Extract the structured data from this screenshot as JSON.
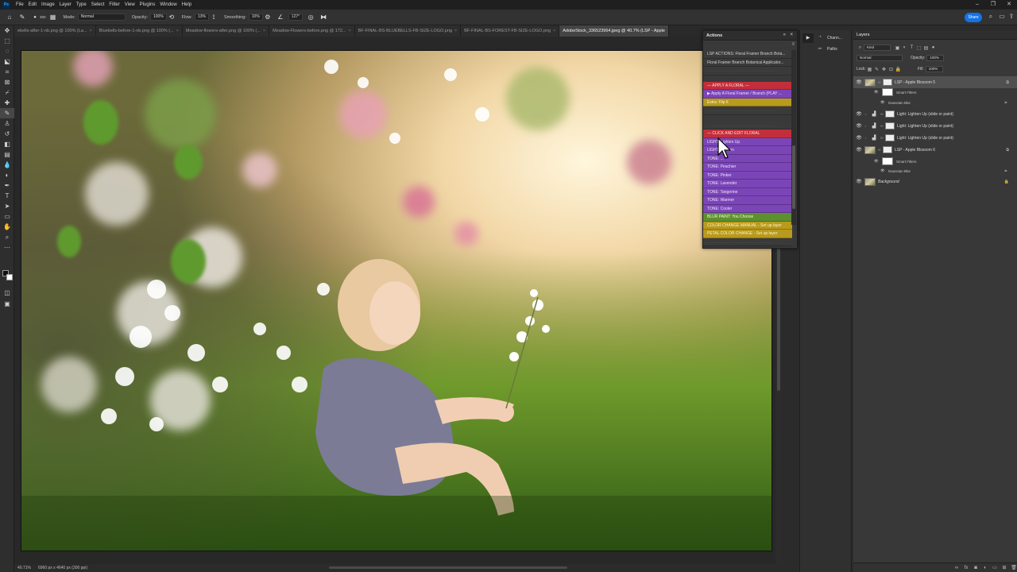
{
  "menubar": {
    "items": [
      "File",
      "Edit",
      "Image",
      "Layer",
      "Type",
      "Select",
      "Filter",
      "View",
      "Plugins",
      "Window",
      "Help"
    ]
  },
  "options": {
    "brush_size": "300",
    "mode_label": "Mode:",
    "mode_value": "Normal",
    "opacity_label": "Opacity:",
    "opacity_value": "100%",
    "flow_label": "Flow:",
    "flow_value": "13%",
    "smoothing_label": "Smoothing:",
    "smoothing_value": "10%",
    "angle_value": "127°",
    "share_label": "Share"
  },
  "tabs": [
    {
      "label": "ebells-after-1-nb.png @ 100% (La..."
    },
    {
      "label": "Bluebells-before-1-nb.png @ 100% (..."
    },
    {
      "label": "Meadow-flowers-after.png @ 100% (..."
    },
    {
      "label": "Meadow-Flowers-before.png @ 172..."
    },
    {
      "label": "BF-FINAL-BS-BLUEBELLS-FB-SIZE-LOGO.png"
    },
    {
      "label": "BF-FINAL-BS-FOREST-FB-SIZE-LOGO.png"
    },
    {
      "label": "AdobeStock_336523964.jpeg @ 40.7% (LSP - Apple"
    }
  ],
  "status": {
    "zoom": "40.71%",
    "dims": "6960 px x 4640 px (300 ppi)"
  },
  "actions": {
    "title": "Actions",
    "rows": [
      {
        "text": "LSP ACTIONS: Floral Framer Branch Bota...",
        "style": "plain"
      },
      {
        "text": "Floral Framer Branch Botanical Applicator...",
        "style": "plain"
      },
      {
        "text": "..........................................",
        "style": "dots"
      },
      {
        "text": "",
        "style": "gap"
      },
      {
        "text": "— APPLY A FLORAL —",
        "style": "red"
      },
      {
        "text": "▶ Apply A Floral Framer / Branch (PLAY ...",
        "style": "purple"
      },
      {
        "text": "Extra: Flip It",
        "style": "gold"
      },
      {
        "text": "..........................................",
        "style": "dots"
      },
      {
        "text": "",
        "style": "gap"
      },
      {
        "text": "..........................................",
        "style": "dots"
      },
      {
        "text": "— CLICK AND EDIT FLORAL",
        "style": "red"
      },
      {
        "text": "LIGHT: Lighten Up",
        "style": "purple"
      },
      {
        "text": "LIGHT: ...Down",
        "style": "purple"
      },
      {
        "text": "TONE: ...",
        "style": "purple"
      },
      {
        "text": "TONE: Peachier",
        "style": "purple"
      },
      {
        "text": "TONE: Pinker",
        "style": "purple"
      },
      {
        "text": "TONE: Lavender",
        "style": "purple"
      },
      {
        "text": "TONE: Tangerine",
        "style": "purple"
      },
      {
        "text": "TONE: Warmer",
        "style": "purple"
      },
      {
        "text": "TONE: Cooler",
        "style": "purple"
      },
      {
        "text": "BLUR PAINT: You Choose",
        "style": "green"
      },
      {
        "text": "COLOR CHANGE MANUAL - Set up layer",
        "style": "gold"
      },
      {
        "text": "PETAL COLOR CHANGE - Set up layer",
        "style": "gold"
      },
      {
        "text": "..........................................",
        "style": "dots"
      }
    ]
  },
  "dock": {
    "channels": "Chann...",
    "paths": "Paths"
  },
  "layers": {
    "title": "Layers",
    "kind": "Kind",
    "blend": "Normal",
    "opacity_label": "Opacity:",
    "opacity_value": "100%",
    "lock_label": "Lock:",
    "fill_label": "Fill:",
    "fill_value": "100%",
    "items": [
      {
        "name": "LSP - Apple Blossom 5",
        "type": "smart"
      },
      {
        "name": "Smart Filters",
        "type": "sub"
      },
      {
        "name": "Gaussian Blur",
        "type": "sub2"
      },
      {
        "name": "Light: Lighten Up (slide or paint)",
        "type": "adj"
      },
      {
        "name": "Light: Lighten Up (slide or paint)",
        "type": "adj"
      },
      {
        "name": "Light: Lighten Up (slide or paint)",
        "type": "adj"
      },
      {
        "name": "LSP - Apple Blossom 6",
        "type": "smart"
      },
      {
        "name": "Smart Filters",
        "type": "sub"
      },
      {
        "name": "Gaussian Blur",
        "type": "sub2"
      },
      {
        "name": "Background",
        "type": "bg"
      }
    ]
  },
  "colors": {
    "accent": "#1473e6",
    "red_row": "#c22f3b",
    "purple_row": "#7b45b8",
    "gold_row": "#b89a1d",
    "green_row": "#5e8f2f"
  }
}
